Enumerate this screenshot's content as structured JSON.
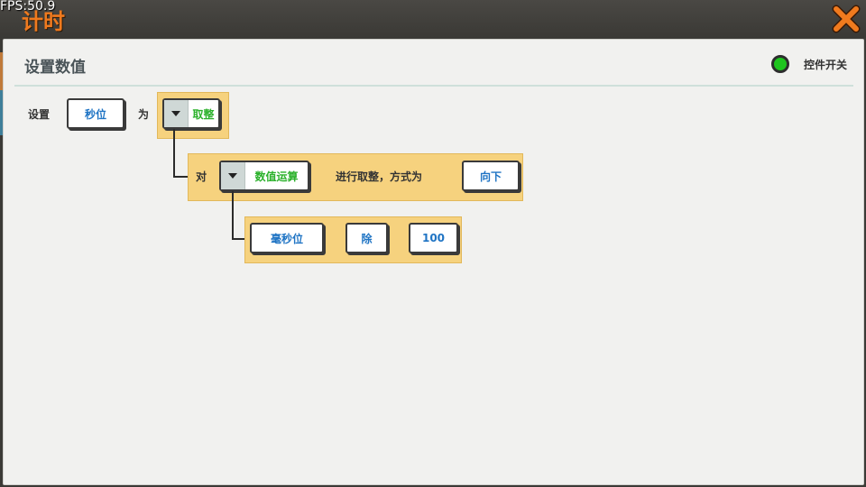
{
  "topbar": {
    "title": "计时",
    "fps": "FPS:50.9",
    "close_icon": "close-x-icon",
    "accent_color": "#f07a1e"
  },
  "panel": {
    "title": "设置数值",
    "toggle": {
      "label": "控件开关",
      "state": "on",
      "color": "#1ec41e"
    }
  },
  "statement": {
    "prefix": "设置",
    "target": "秒位",
    "as_label": "为",
    "func": "取整"
  },
  "round_block": {
    "prefix": "对",
    "operand": "数值运算",
    "mid_text": "进行取整，方式为",
    "mode": "向下"
  },
  "math_block": {
    "left": "毫秒位",
    "operator": "除",
    "right": "100"
  }
}
